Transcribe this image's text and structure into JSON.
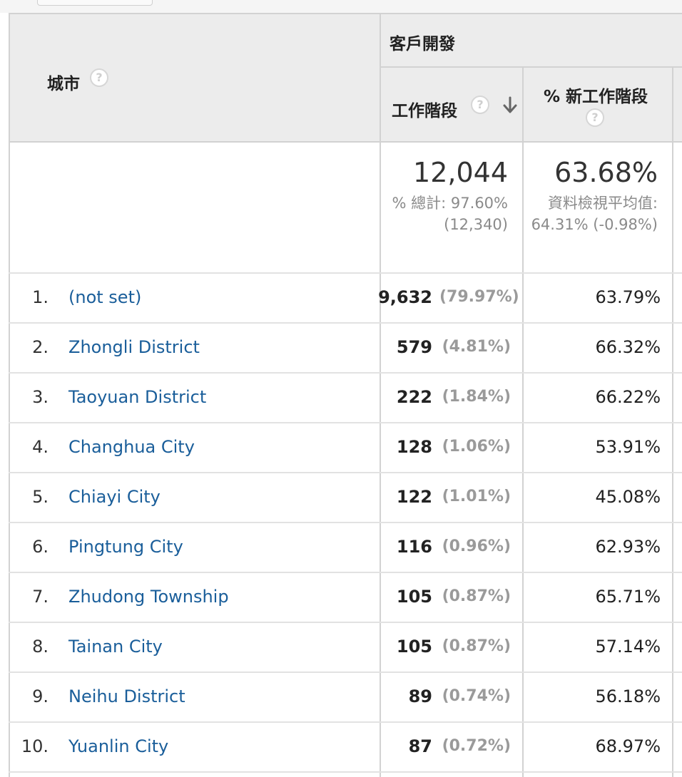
{
  "header": {
    "dimension_label": "城市",
    "group_label": "客戶開發",
    "col_sessions": "工作階段",
    "col_new_sessions": "% 新工作階段"
  },
  "totals": {
    "sessions_value": "12,044",
    "sessions_sub1": "% 總計: 97.60%",
    "sessions_sub2": "(12,340)",
    "new_value": "63.68%",
    "new_sub1": "資料檢視平均值:",
    "new_sub2": "64.31% (-0.98%)"
  },
  "rows": [
    {
      "rank": "1.",
      "city": "(not set)",
      "sessions": "9,632",
      "pct": "(79.97%)",
      "new": "63.79%"
    },
    {
      "rank": "2.",
      "city": "Zhongli District",
      "sessions": "579",
      "pct": "(4.81%)",
      "new": "66.32%"
    },
    {
      "rank": "3.",
      "city": "Taoyuan District",
      "sessions": "222",
      "pct": "(1.84%)",
      "new": "66.22%"
    },
    {
      "rank": "4.",
      "city": "Changhua City",
      "sessions": "128",
      "pct": "(1.06%)",
      "new": "53.91%"
    },
    {
      "rank": "5.",
      "city": "Chiayi City",
      "sessions": "122",
      "pct": "(1.01%)",
      "new": "45.08%"
    },
    {
      "rank": "6.",
      "city": "Pingtung City",
      "sessions": "116",
      "pct": "(0.96%)",
      "new": "62.93%"
    },
    {
      "rank": "7.",
      "city": "Zhudong Township",
      "sessions": "105",
      "pct": "(0.87%)",
      "new": "65.71%"
    },
    {
      "rank": "8.",
      "city": "Tainan City",
      "sessions": "105",
      "pct": "(0.87%)",
      "new": "57.14%"
    },
    {
      "rank": "9.",
      "city": "Neihu District",
      "sessions": "89",
      "pct": "(0.74%)",
      "new": "56.18%"
    },
    {
      "rank": "10.",
      "city": "Yuanlin City",
      "sessions": "87",
      "pct": "(0.72%)",
      "new": "68.97%"
    }
  ],
  "icons": {
    "help": "help-icon",
    "sort": "sort-descending-icon"
  },
  "colors": {
    "link": "#1a5e9a",
    "header_bg": "#ececec"
  }
}
